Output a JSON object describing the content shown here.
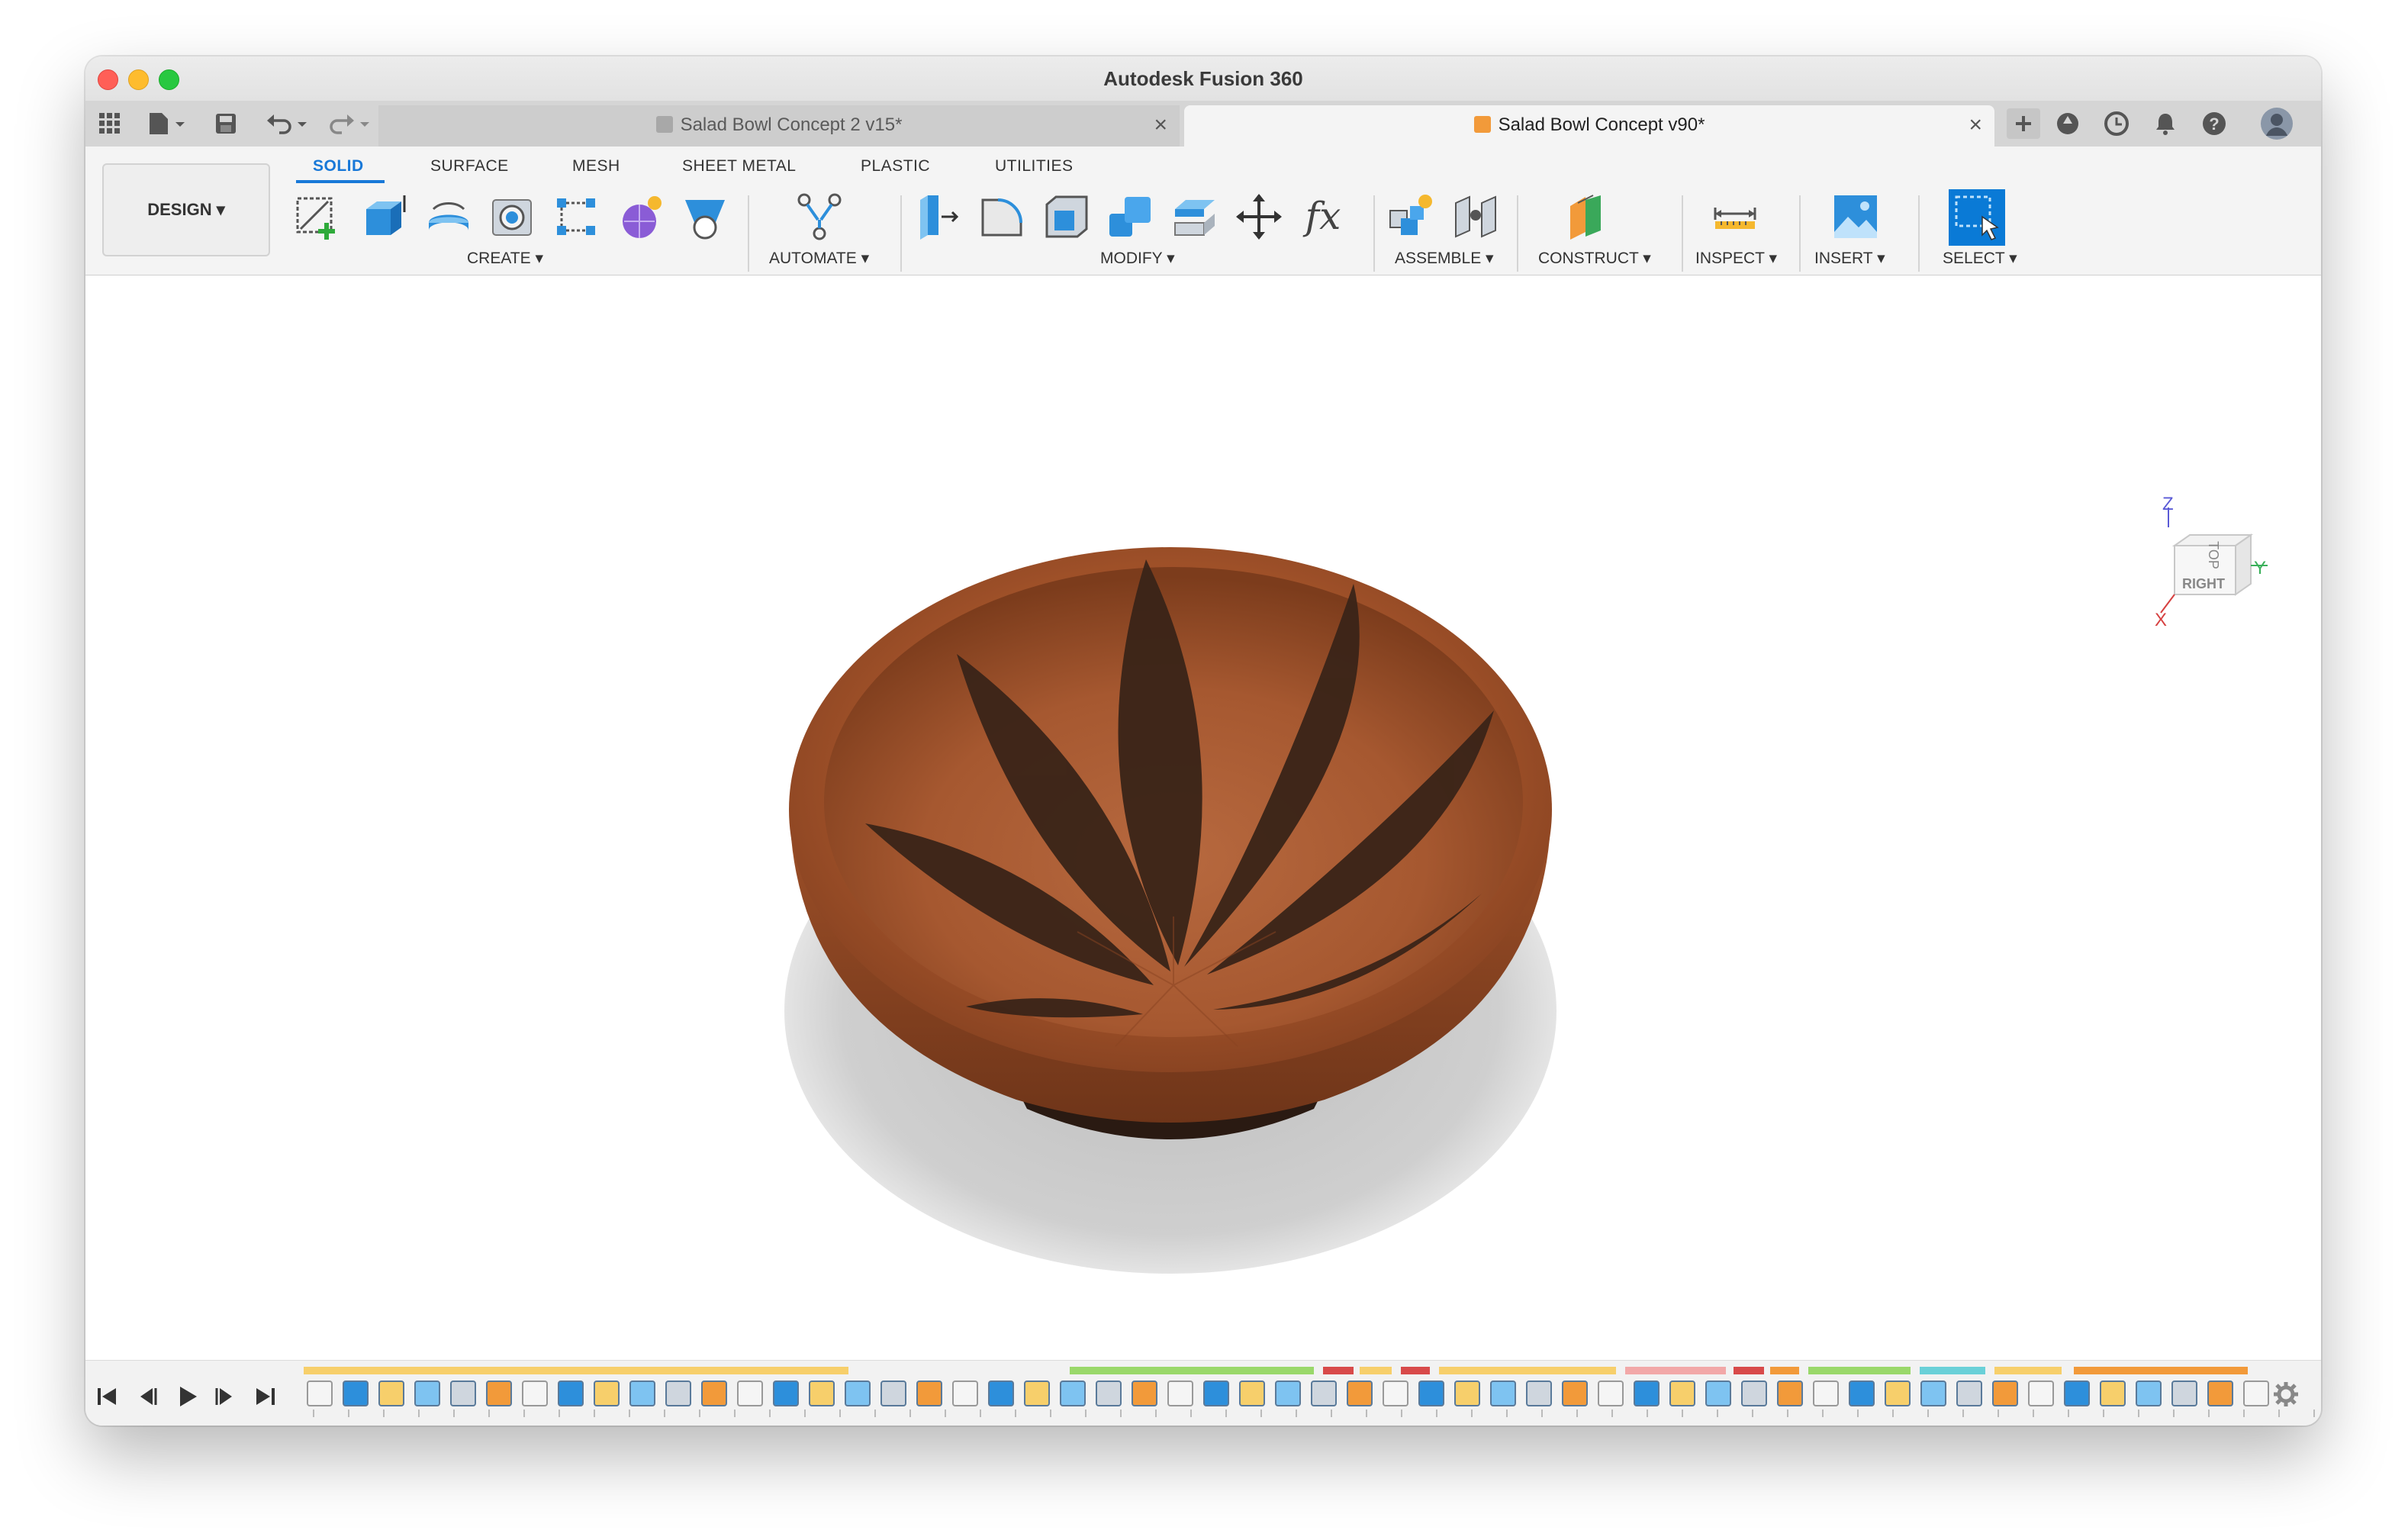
{
  "window": {
    "title": "Autodesk Fusion 360"
  },
  "tabs": [
    {
      "label": "Salad Bowl Concept 2 v15*",
      "active": false
    },
    {
      "label": "Salad Bowl Concept v90*",
      "active": true
    }
  ],
  "workspace": {
    "label": "DESIGN"
  },
  "ribbon_tabs": [
    "SOLID",
    "SURFACE",
    "MESH",
    "SHEET METAL",
    "PLASTIC",
    "UTILITIES"
  ],
  "groups": {
    "create": "CREATE",
    "automate": "AUTOMATE",
    "modify": "MODIFY",
    "assemble": "ASSEMBLE",
    "construct": "CONSTRUCT",
    "inspect": "INSPECT",
    "insert": "INSERT",
    "select": "SELECT"
  },
  "viewcube": {
    "top": "TOP",
    "right": "RIGHT",
    "axis_x": "X",
    "axis_y": "Y",
    "axis_z": "Z"
  },
  "colors": {
    "accent": "#1878d8",
    "wood": "#a8562c",
    "dark_wood": "#3a2418"
  }
}
